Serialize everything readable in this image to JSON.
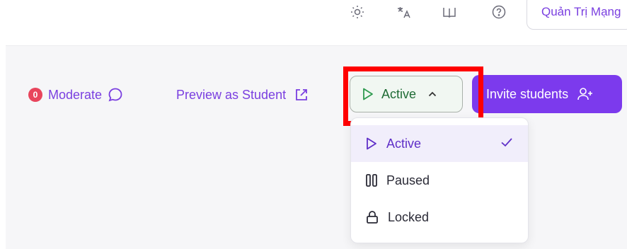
{
  "header": {
    "user_name": "Quản Trị Mạng",
    "icons": [
      "brightness-icon",
      "translate-icon",
      "book-icon",
      "help-icon"
    ]
  },
  "toolbar": {
    "moderate": {
      "badge_count": "0",
      "label": "Moderate",
      "icon": "chat-bubble-icon"
    },
    "preview": {
      "label": "Preview as Student",
      "icon": "external-link-icon"
    },
    "status_button": {
      "label": "Active",
      "icon": "play-icon",
      "chevron": "chevron-up-icon"
    },
    "invite": {
      "label": "Invite students",
      "icon": "add-user-icon"
    }
  },
  "status_menu": {
    "items": [
      {
        "label": "Active",
        "icon": "play-icon",
        "selected": true
      },
      {
        "label": "Paused",
        "icon": "pause-icon",
        "selected": false
      },
      {
        "label": "Locked",
        "icon": "lock-icon",
        "selected": false
      }
    ]
  },
  "colors": {
    "brand_purple": "#7c3aed",
    "active_green": "#1f6b35",
    "badge_red": "#e8455c",
    "highlight_red": "#ff0000"
  }
}
